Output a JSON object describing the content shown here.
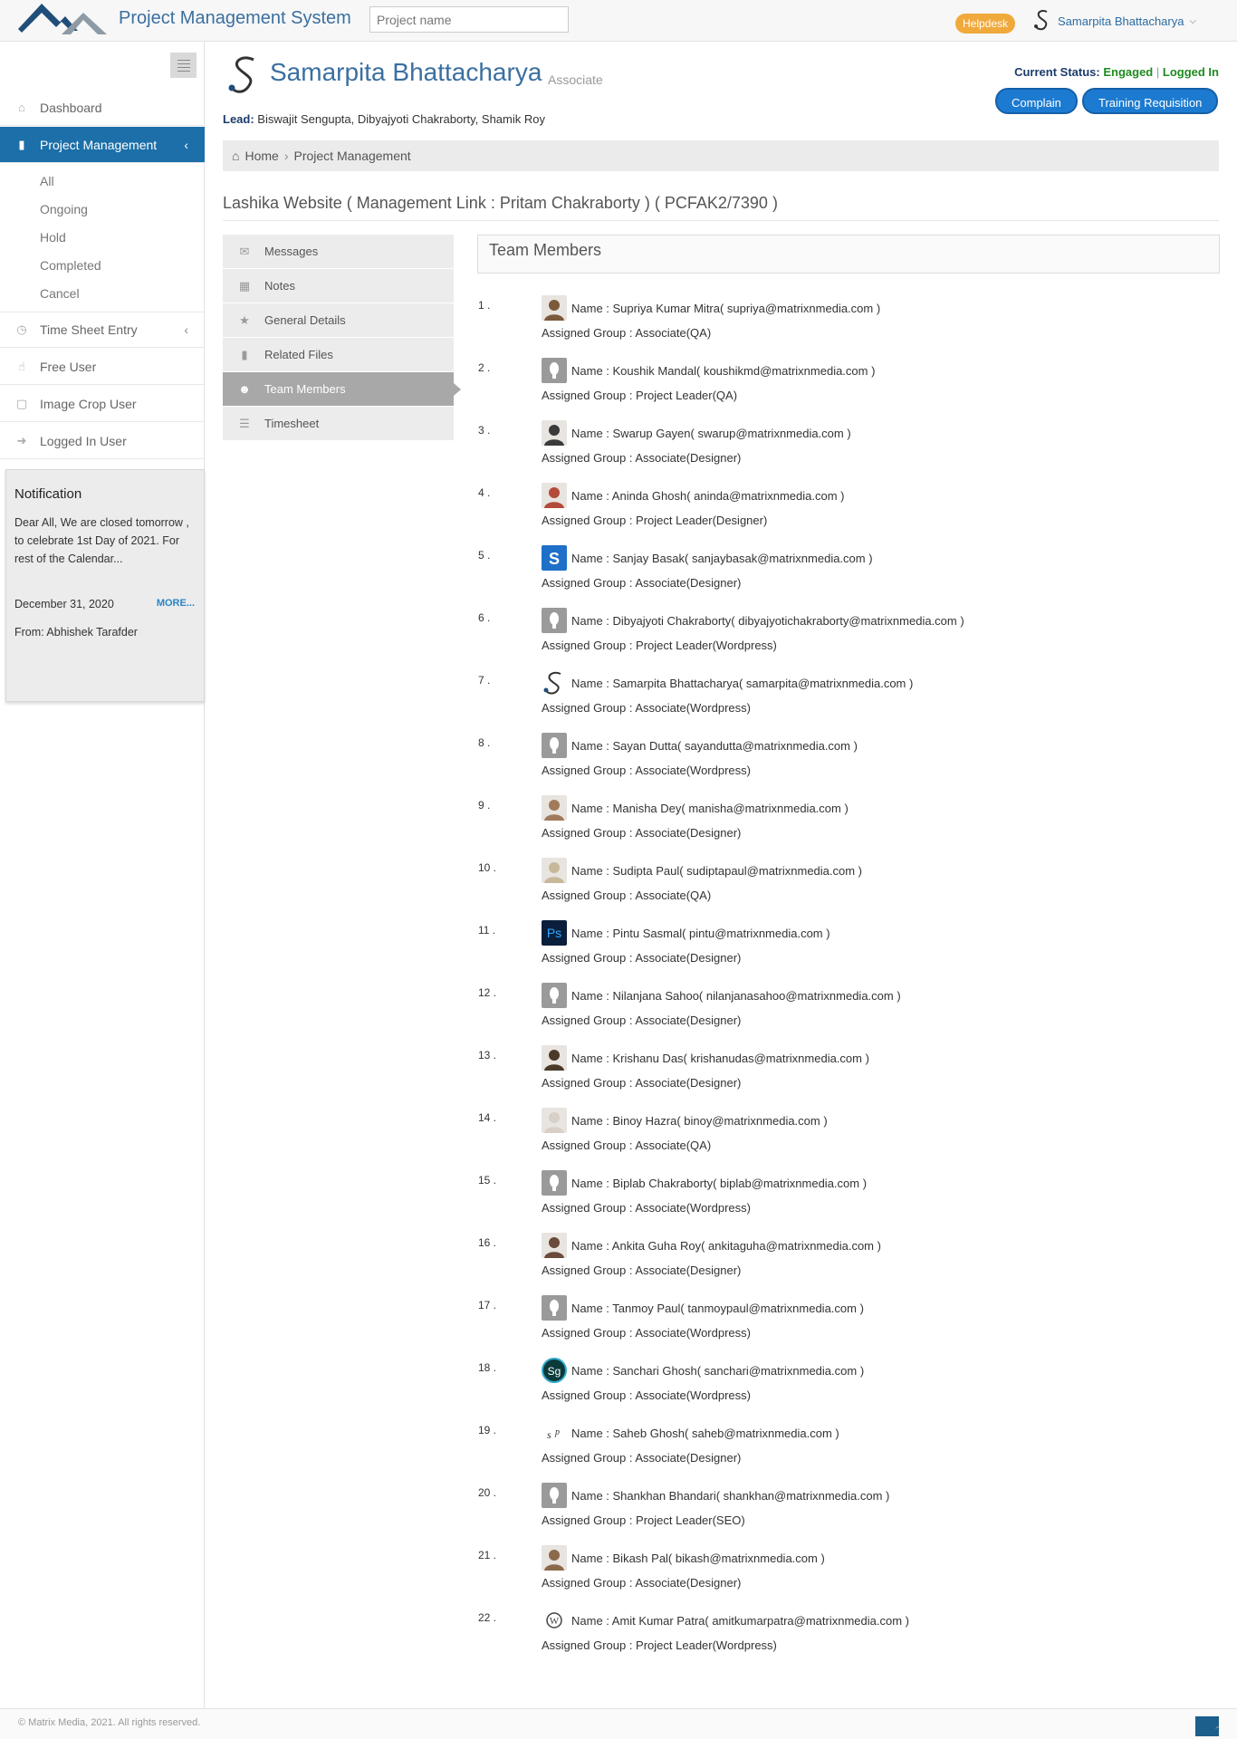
{
  "topbar": {
    "app_title": "Project Management System",
    "search_placeholder": "Project name",
    "helpdesk": "Helpdesk",
    "user_name": "Samarpita Bhattacharya"
  },
  "sidebar": {
    "items": [
      {
        "label": "Dashboard",
        "icon": "home-icon"
      },
      {
        "label": "Project Management",
        "icon": "file-icon"
      },
      {
        "label": "Time Sheet Entry",
        "icon": "clock-icon"
      },
      {
        "label": "Free User",
        "icon": "hand-icon"
      },
      {
        "label": "Image Crop User",
        "icon": "crop-icon"
      },
      {
        "label": "Logged In User",
        "icon": "sign-in-icon"
      }
    ],
    "sub_items": [
      "All",
      "Ongoing",
      "Hold",
      "Completed",
      "Cancel"
    ]
  },
  "notification": {
    "title": "Notification",
    "text": "Dear All, We are closed tomorrow , to celebrate 1st Day of 2021. For rest of the Calendar...",
    "date": "December 31, 2020",
    "more": "MORE...",
    "from": "From: Abhishek Tarafder"
  },
  "profile": {
    "name": "Samarpita Bhattacharya",
    "role": "Associate",
    "lead_label": "Lead:",
    "lead_names": "Biswajit Sengupta, Dibyajyoti Chakraborty, Shamik Roy",
    "status_label": "Current Status:",
    "status_value": "Engaged",
    "status_sep": "|",
    "login_status": "Logged In",
    "complain_btn": "Complain",
    "training_btn": "Training Requisition"
  },
  "breadcrumb": {
    "home": "Home",
    "current": "Project Management"
  },
  "project_title": "Lashika Website ( Management Link : Pritam Chakraborty ) ( PCFAK2/7390 )",
  "tabs": [
    {
      "label": "Messages",
      "icon": "envelope-icon"
    },
    {
      "label": "Notes",
      "icon": "grid-icon"
    },
    {
      "label": "General Details",
      "icon": "star-icon"
    },
    {
      "label": "Related Files",
      "icon": "file-icon"
    },
    {
      "label": "Team Members",
      "icon": "users-icon"
    },
    {
      "label": "Timesheet",
      "icon": "list-icon"
    }
  ],
  "team_header": "Team Members",
  "members": [
    {
      "num": "1 .",
      "name": "Name : Supriya Kumar Mitra( supriya@matrixnmedia.com )",
      "group": "Assigned Group : Associate(QA)",
      "avatar": "photo",
      "color": "#7a5a3a"
    },
    {
      "num": "2 .",
      "name": "Name : Koushik Mandal( koushikmd@matrixnmedia.com )",
      "group": "Assigned Group : Project Leader(QA)",
      "avatar": "default",
      "color": "#9a9a9a"
    },
    {
      "num": "3 .",
      "name": "Name : Swarup Gayen( swarup@matrixnmedia.com )",
      "group": "Assigned Group : Associate(Designer)",
      "avatar": "photo",
      "color": "#3a3a3a"
    },
    {
      "num": "4 .",
      "name": "Name : Aninda Ghosh( aninda@matrixnmedia.com )",
      "group": "Assigned Group : Project Leader(Designer)",
      "avatar": "photo",
      "color": "#b44a3a"
    },
    {
      "num": "5 .",
      "name": "Name : Sanjay Basak( sanjaybasak@matrixnmedia.com )",
      "group": "Assigned Group : Associate(Designer)",
      "avatar": "letter-s",
      "color": "#1e70c8"
    },
    {
      "num": "6 .",
      "name": "Name : Dibyajyoti Chakraborty( dibyajyotichakraborty@matrixnmedia.com )",
      "group": "Assigned Group : Project Leader(Wordpress)",
      "avatar": "default",
      "color": "#9a9a9a"
    },
    {
      "num": "7 .",
      "name": "Name : Samarpita Bhattacharya( samarpita@matrixnmedia.com )",
      "group": "Assigned Group : Associate(Wordpress)",
      "avatar": "swirl",
      "color": "#ffffff"
    },
    {
      "num": "8 .",
      "name": "Name : Sayan Dutta( sayandutta@matrixnmedia.com )",
      "group": "Assigned Group : Associate(Wordpress)",
      "avatar": "default",
      "color": "#9a9a9a"
    },
    {
      "num": "9 .",
      "name": "Name : Manisha Dey( manisha@matrixnmedia.com )",
      "group": "Assigned Group : Associate(Designer)",
      "avatar": "photo",
      "color": "#a07a5a"
    },
    {
      "num": "10 .",
      "name": "Name : Sudipta Paul( sudiptapaul@matrixnmedia.com )",
      "group": "Assigned Group : Associate(QA)",
      "avatar": "photo",
      "color": "#c8b89a"
    },
    {
      "num": "11 .",
      "name": "Name : Pintu Sasmal( pintu@matrixnmedia.com )",
      "group": "Assigned Group : Associate(Designer)",
      "avatar": "ps",
      "color": "#0a1f3c"
    },
    {
      "num": "12 .",
      "name": "Name : Nilanjana Sahoo( nilanjanasahoo@matrixnmedia.com )",
      "group": "Assigned Group : Associate(Designer)",
      "avatar": "default",
      "color": "#9a9a9a"
    },
    {
      "num": "13 .",
      "name": "Name : Krishanu Das( krishanudas@matrixnmedia.com )",
      "group": "Assigned Group : Associate(Designer)",
      "avatar": "photo",
      "color": "#4a3a2a"
    },
    {
      "num": "14 .",
      "name": "Name : Binoy Hazra( binoy@matrixnmedia.com )",
      "group": "Assigned Group : Associate(QA)",
      "avatar": "photo",
      "color": "#d8d0c8"
    },
    {
      "num": "15 .",
      "name": "Name : Biplab Chakraborty( biplab@matrixnmedia.com )",
      "group": "Assigned Group : Associate(Wordpress)",
      "avatar": "default",
      "color": "#9a9a9a"
    },
    {
      "num": "16 .",
      "name": "Name : Ankita Guha Roy( ankitaguha@matrixnmedia.com )",
      "group": "Assigned Group : Associate(Designer)",
      "avatar": "photo",
      "color": "#6a4a3a"
    },
    {
      "num": "17 .",
      "name": "Name : Tanmoy Paul( tanmoypaul@matrixnmedia.com )",
      "group": "Assigned Group : Associate(Wordpress)",
      "avatar": "default",
      "color": "#9a9a9a"
    },
    {
      "num": "18 .",
      "name": "Name : Sanchari Ghosh( sanchari@matrixnmedia.com )",
      "group": "Assigned Group : Associate(Wordpress)",
      "avatar": "sg",
      "color": "#0a3a3a"
    },
    {
      "num": "19 .",
      "name": "Name : Saheb Ghosh( saheb@matrixnmedia.com )",
      "group": "Assigned Group : Associate(Designer)",
      "avatar": "sp",
      "color": "#ffffff"
    },
    {
      "num": "20 .",
      "name": "Name : Shankhan Bhandari( shankhan@matrixnmedia.com )",
      "group": "Assigned Group : Project Leader(SEO)",
      "avatar": "default",
      "color": "#9a9a9a"
    },
    {
      "num": "21 .",
      "name": "Name : Bikash Pal( bikash@matrixnmedia.com )",
      "group": "Assigned Group : Associate(Designer)",
      "avatar": "photo",
      "color": "#8a6a4a"
    },
    {
      "num": "22 .",
      "name": "Name : Amit Kumar Patra( amitkumarpatra@matrixnmedia.com )",
      "group": "Assigned Group : Project Leader(Wordpress)",
      "avatar": "wp",
      "color": "#ffffff"
    }
  ],
  "footer": {
    "copyright": "© Matrix Media, 2021. All rights reserved."
  }
}
